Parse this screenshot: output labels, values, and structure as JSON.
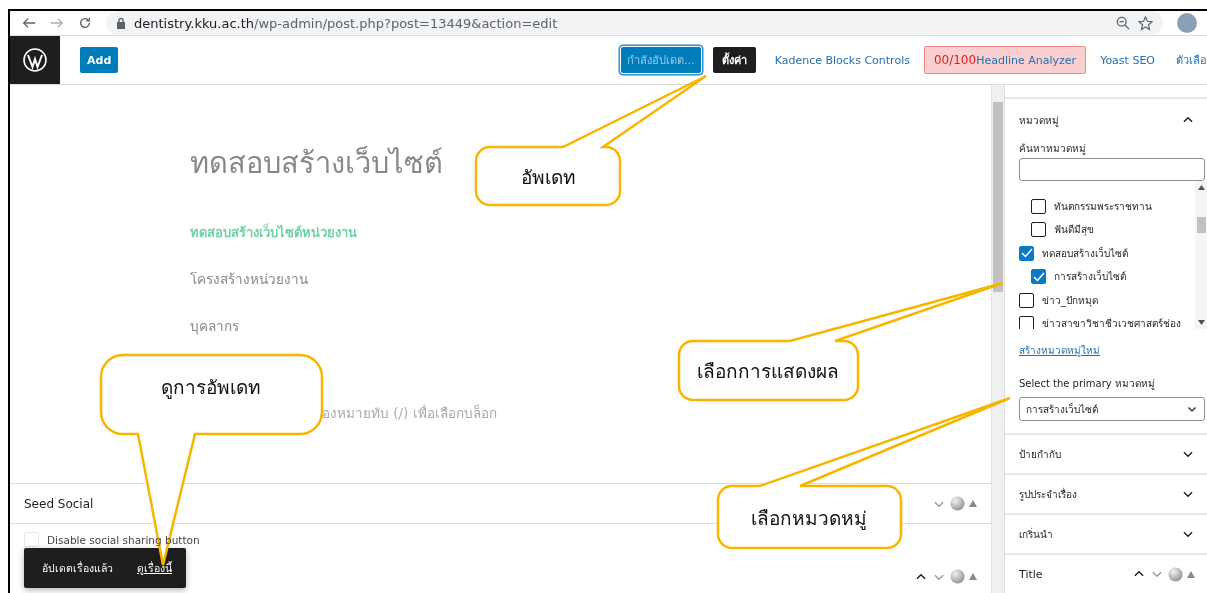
{
  "browser": {
    "url_host": "dentistry.kku.ac.th",
    "url_path": "/wp-admin/post.php?post=13449&action=edit"
  },
  "toolbar": {
    "add_button": "Add",
    "items": [
      {
        "kind": "primary",
        "label": "กำลังอัปเดต...",
        "busy": true
      },
      {
        "kind": "dark",
        "label": "ตั้งค่า"
      },
      {
        "kind": "link",
        "label": "Kadence Blocks Controls"
      },
      {
        "kind": "score",
        "score": "00/100",
        "label": "Headline Analyzer"
      },
      {
        "kind": "link",
        "label": "Yoast SEO"
      },
      {
        "kind": "link",
        "label": "ตัวเลือ"
      }
    ]
  },
  "editor": {
    "title": "ทดสอบสร้างเว็บไซต์",
    "blocks": [
      {
        "kind": "link",
        "text": "ทดสอบสร้างเว็บไซต์หน่วยงาน"
      },
      {
        "kind": "text",
        "text": "โครงสร้างหน่วยงาน"
      },
      {
        "kind": "text",
        "text": "บุคลากร"
      },
      {
        "kind": "placeholder",
        "text": "องหมายทับ (/) เพื่อเลือกบล็อก"
      }
    ]
  },
  "meta_box": {
    "title": "Seed Social",
    "option": {
      "label": "Disable social sharing button",
      "checked": false
    }
  },
  "notice": {
    "message": "อัปเดตเรื่องแล้ว",
    "link": "ดูเรื่องนี้"
  },
  "sidebar": {
    "categories": {
      "title": "หมวดหมู่",
      "expanded": true,
      "search_label": "ค้นหาหมวดหมู่",
      "items": [
        {
          "children": [
            {
              "label": "ทันตกรรมพระราชทาน",
              "checked": false
            },
            {
              "label": "ฟันดีมีสุข",
              "checked": false
            }
          ]
        },
        {
          "label": "ทดสอบสร้างเว็บไซต์",
          "checked": true,
          "children": [
            {
              "label": "การสร้างเว็บไซต์",
              "checked": true
            }
          ]
        },
        {
          "label": "ข่าว_ปักหมุด",
          "checked": false
        },
        {
          "label": "ข่าวสาขาวิชาชีวเวชศาสตร์ช่อง",
          "checked": false
        }
      ],
      "add_link": "สร้างหมวดหมู่ใหม่",
      "primary_label": "Select the primary หมวดหมู่",
      "primary_value": "การสร้างเว็บไซต์"
    },
    "panels": [
      {
        "title": "ป้ายกำกับ",
        "expanded": false
      },
      {
        "title": "รูปประจำเรื่อง",
        "expanded": false
      },
      {
        "title": "เกริ่นนำ",
        "expanded": false
      }
    ],
    "title_box": "Title"
  },
  "annotations": [
    {
      "text": "อัพเดท"
    },
    {
      "text": "ดูการอัพเดท"
    },
    {
      "text": "เลือกการแสดงผล"
    },
    {
      "text": "เลือกหมวดหมู่"
    }
  ]
}
